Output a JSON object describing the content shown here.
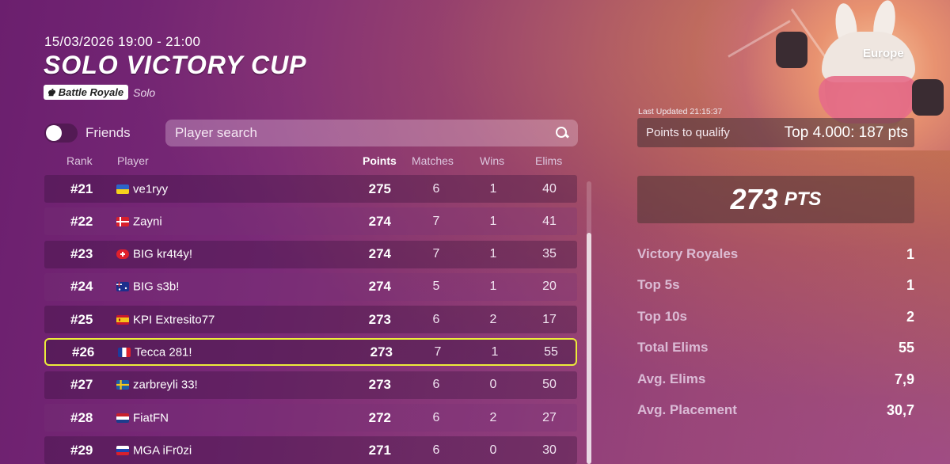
{
  "event": {
    "date": "15/03/2026 19:00 - 21:00",
    "title": "SOLO VICTORY CUP",
    "mode_badge": "Battle Royale",
    "mode_sub": "Solo",
    "region": "Europe"
  },
  "controls": {
    "friends_label": "Friends",
    "friends_toggle_on": false,
    "search_placeholder": "Player search"
  },
  "columns": {
    "rank": "Rank",
    "player": "Player",
    "points": "Points",
    "matches": "Matches",
    "wins": "Wins",
    "elims": "Elims"
  },
  "rows": [
    {
      "rank": "#21",
      "flag": "ukraine",
      "name": "ve1ryy",
      "points": "275",
      "matches": "6",
      "wins": "1",
      "elims": "40"
    },
    {
      "rank": "#22",
      "flag": "denmark",
      "name": "Zayni",
      "points": "274",
      "matches": "7",
      "wins": "1",
      "elims": "41"
    },
    {
      "rank": "#23",
      "flag": "switzerland",
      "name": "BIG kr4t4y!",
      "points": "274",
      "matches": "7",
      "wins": "1",
      "elims": "35"
    },
    {
      "rank": "#24",
      "flag": "australia",
      "name": "BIG s3b!",
      "points": "274",
      "matches": "5",
      "wins": "1",
      "elims": "20"
    },
    {
      "rank": "#25",
      "flag": "spain",
      "name": "KPI Extresito77",
      "points": "273",
      "matches": "6",
      "wins": "2",
      "elims": "17"
    },
    {
      "rank": "#26",
      "flag": "france",
      "name": "Tecca 281!",
      "points": "273",
      "matches": "7",
      "wins": "1",
      "elims": "55",
      "highlighted": true
    },
    {
      "rank": "#27",
      "flag": "sweden",
      "name": "zarbreyli 33!",
      "points": "273",
      "matches": "6",
      "wins": "0",
      "elims": "50"
    },
    {
      "rank": "#28",
      "flag": "netherlands",
      "name": "FiatFN",
      "points": "272",
      "matches": "6",
      "wins": "2",
      "elims": "27"
    },
    {
      "rank": "#29",
      "flag": "russia",
      "name": "MGA iFr0zi",
      "points": "271",
      "matches": "6",
      "wins": "0",
      "elims": "30"
    }
  ],
  "summary": {
    "last_updated": "Last Updated 21:15:37",
    "qualify_label": "Points to qualify",
    "qualify_value": "Top 4.000: 187 pts",
    "points_value": "273",
    "points_unit": "PTS",
    "stats": [
      {
        "label": "Victory Royales",
        "value": "1"
      },
      {
        "label": "Top 5s",
        "value": "1"
      },
      {
        "label": "Top 10s",
        "value": "2"
      },
      {
        "label": "Total Elims",
        "value": "55"
      },
      {
        "label": "Avg. Elims",
        "value": "7,9"
      },
      {
        "label": "Avg. Placement",
        "value": "30,7"
      }
    ]
  },
  "colors": {
    "highlight_border": "#ecec3a",
    "background_start": "#6b1f6e",
    "background_end": "#a85a4c"
  },
  "icons": {
    "mode_badge_icon": "crown-icon",
    "search_icon": "magnifier-icon"
  }
}
